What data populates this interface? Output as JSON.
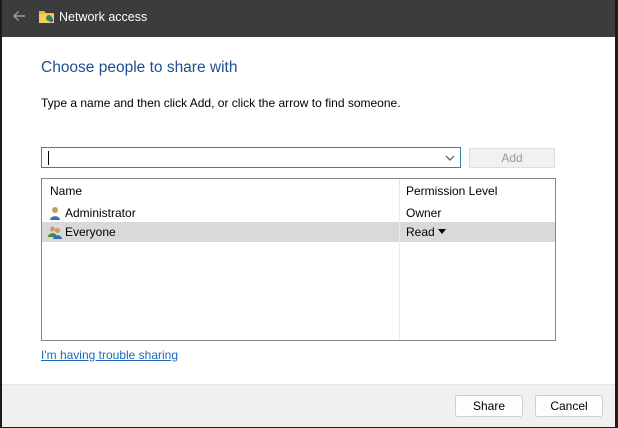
{
  "window": {
    "title": "Network access",
    "title_icon": "shared-folder-icon",
    "back_icon": "back-arrow-icon"
  },
  "main": {
    "heading": "Choose people to share with",
    "instruction": "Type a name and then click Add, or click the arrow to find someone."
  },
  "name_input": {
    "value": "",
    "placeholder": "",
    "dropdown_icon": "chevron-down-icon"
  },
  "add_button": {
    "label": "Add",
    "enabled": false
  },
  "list": {
    "columns": [
      "Name",
      "Permission Level"
    ],
    "rows": [
      {
        "name": "Administrator",
        "permission": "Owner",
        "icon": "user-icon",
        "selected": false
      },
      {
        "name": "Everyone",
        "permission": "Read",
        "icon": "group-icon",
        "selected": true
      }
    ]
  },
  "trouble_link": "I'm having trouble sharing",
  "footer": {
    "share_label": "Share",
    "cancel_label": "Cancel"
  }
}
